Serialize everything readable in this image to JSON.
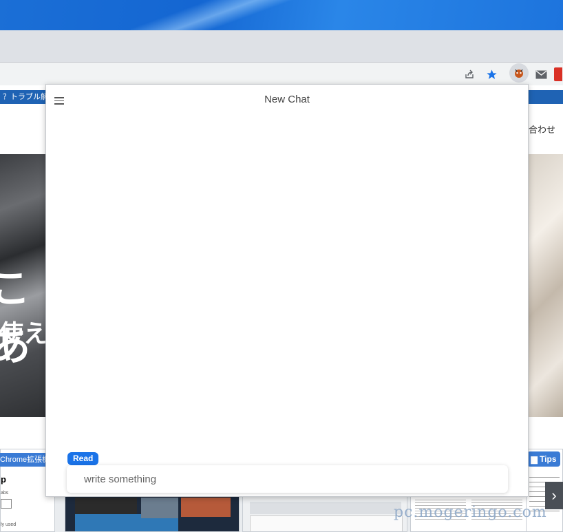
{
  "browser": {
    "toolbar_icons": [
      "share-icon",
      "bookmark-star-icon",
      "extension-icon",
      "mail-icon",
      "extension-red-icon"
    ],
    "accent_star": "#1a73e8"
  },
  "background_page": {
    "nav_left_text": "？トラブル解",
    "contact_text": "合わせ",
    "hero_big_text": "こあ",
    "hero_mid_text": "使え",
    "thumb_label_left": "Chrome拡張機",
    "tips_badge": "Tips",
    "watermark": "pc.mogeringo.com"
  },
  "popup": {
    "title": "New Chat",
    "mode_badge": "Read",
    "input_placeholder": "write something",
    "input_value": "",
    "badge_color": "#1a73e8"
  }
}
